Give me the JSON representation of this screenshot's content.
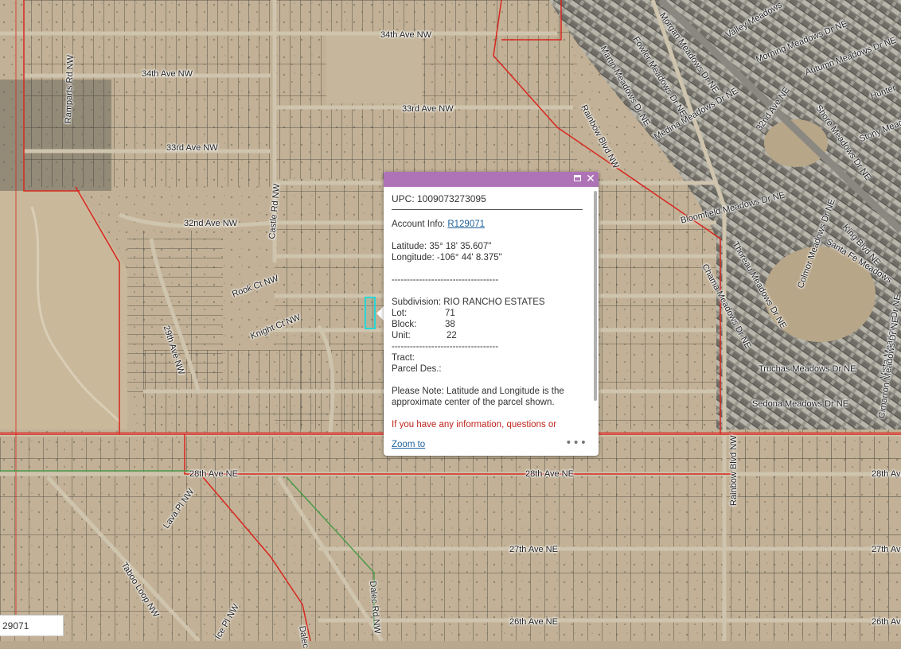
{
  "map": {
    "colors": {
      "background": "#b9a88d",
      "parcel_line": "#3b3a36",
      "boundary": "#d8261f",
      "urban": "#8c8a80",
      "road": "#cfc4ad",
      "highlight": "#28d6d6"
    },
    "streets": [
      {
        "label": "34th Ave NW"
      },
      {
        "label": "34th Ave NW"
      },
      {
        "label": "33rd Ave NW"
      },
      {
        "label": "33rd Ave NW"
      },
      {
        "label": "32nd Ave NW"
      },
      {
        "label": "Castle Rd NW"
      },
      {
        "label": "Ramparts Rd NW"
      },
      {
        "label": "Rook Ct NW"
      },
      {
        "label": "Knight Ct NW"
      },
      {
        "label": "29th Ave NW"
      },
      {
        "label": "28th Ave NE"
      },
      {
        "label": "28th Ave NE"
      },
      {
        "label": "28th Ave"
      },
      {
        "label": "27th Ave NE"
      },
      {
        "label": "27th Ave"
      },
      {
        "label": "26th Ave NE"
      },
      {
        "label": "26th Ave"
      },
      {
        "label": "Lava Pl NW"
      },
      {
        "label": "Taboo Loop NW"
      },
      {
        "label": "Rainbow Blvd NW"
      },
      {
        "label": "Rainbow Blvd NW"
      },
      {
        "label": "Martin Meadows Dr NE"
      },
      {
        "label": "Fowler Meadows Dr NE"
      },
      {
        "label": "Morgan Meadows Dr NE"
      },
      {
        "label": "Valley Meadows"
      },
      {
        "label": "Morning Meadows Dr NE"
      },
      {
        "label": "Autumn Meadows Dr NE"
      },
      {
        "label": "Medina Meadows Dr NE"
      },
      {
        "label": "32nd Ave NE"
      },
      {
        "label": "Shore Meadows Dr NE"
      },
      {
        "label": "Hunter"
      },
      {
        "label": "Stony Meado"
      },
      {
        "label": "Bloomfield Meadows Dr NE"
      },
      {
        "label": "King Blvd NE"
      },
      {
        "label": "Santa Fe Meadows"
      },
      {
        "label": "Colmor Meadows Dr NE"
      },
      {
        "label": "Truchas Meadows Dr NE"
      },
      {
        "label": "Sedona Meadows Dr NE"
      },
      {
        "label": "Chama Meadows Dr NE"
      },
      {
        "label": "Thoreau Meadows Dr NE"
      },
      {
        "label": "Vista Meadows Dr NE"
      },
      {
        "label": "Cimarron Meadows Dr NE"
      },
      {
        "label": "Dalec"
      },
      {
        "label": "Dalec Rd NW"
      },
      {
        "label": "Ice Pl NW"
      }
    ]
  },
  "popup": {
    "upc": "UPC: 1009073273095",
    "account_label": "Account Info: ",
    "account_link": "R129071",
    "latitude": "Latitude: 35° 18' 35.607\"",
    "longitude": "Longitude: -106° 44' 8.375\"",
    "separator": "-----------------------------------",
    "subdivision": "Subdivision: RIO RANCHO ESTATES",
    "lot_label": "Lot:",
    "lot_value": "71",
    "block_label": "Block:",
    "block_value": "38",
    "unit_label": "Unit:",
    "unit_value": "22",
    "tract": "Tract:",
    "parcel_des": "Parcel Des.:",
    "note": "Please Note: Latitude and Longitude is the approximate center of the parcel shown.",
    "contact_note": "If you have any information, questions or concerns about this parcel, please contact",
    "zoom_label": "Zoom to",
    "more_label": "•••",
    "maximize_icon": "maximize-icon",
    "close_icon": "close-icon",
    "close_glyph": "✕"
  },
  "search": {
    "value": "29071"
  }
}
